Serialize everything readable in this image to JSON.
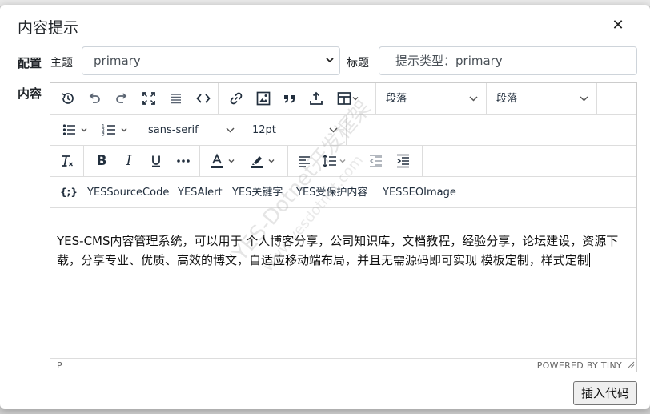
{
  "modal": {
    "title": "内容提示",
    "close_label": "✕"
  },
  "config": {
    "section_label": "配置",
    "theme_label": "主题",
    "theme_value": "primary",
    "title_label": "标题",
    "title_value": "提示类型：primary"
  },
  "content_label": "内容",
  "editor": {
    "block_format_1": "段落",
    "block_format_2": "段落",
    "font_family": "sans-serif",
    "font_size": "12pt",
    "plugins": [
      "YESSourceCode",
      "YESAlert",
      "YES关键字",
      "YES受保护内容",
      "YESSEOImage"
    ],
    "plugin_icon": "{;}",
    "body_text": "YES-CMS内容管理系统，可以用于 个人博客分享，公司知识库，文档教程，经验分享，论坛建设，资源下载，分享专业、优质、高效的博文，自适应移动端布局，并且无需源码即可实现 模板定制，样式定制",
    "status_path": "P",
    "status_brand": "POWERED BY TINY"
  },
  "insert_button": "插入代码",
  "watermark": {
    "line1": "YES-Dotnet开发框架",
    "line2": "www.yesdotnet.com"
  }
}
